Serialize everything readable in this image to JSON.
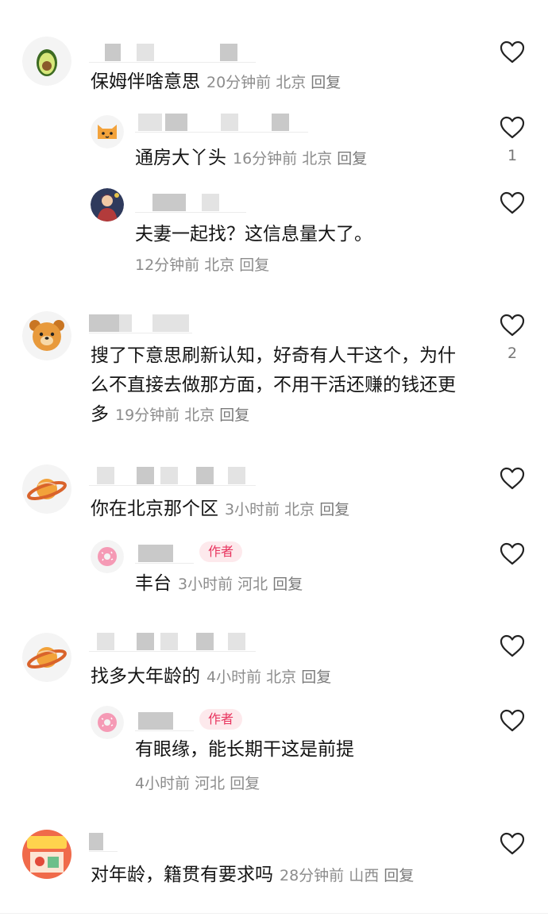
{
  "colors": {
    "badge_bg": "#fde9ec",
    "badge_text": "#e8345e",
    "meta": "#8c8c8c"
  },
  "comments": [
    {
      "avatar_icon": "avocado-icon",
      "text": "保姆伴啥意思",
      "time": "20分钟前",
      "location": "北京",
      "reply": "回复",
      "likes": "",
      "replies": [
        {
          "avatar_icon": "cat-face-icon",
          "text": "通房大丫头",
          "time": "16分钟前",
          "location": "北京",
          "reply": "回复",
          "likes": "1"
        },
        {
          "avatar_icon": "anime-character-icon",
          "text": "夫妻一起找？这信息量大了。",
          "time": "12分钟前",
          "location": "北京",
          "reply": "回复",
          "likes": ""
        }
      ]
    },
    {
      "avatar_icon": "bear-face-icon",
      "text": "搜了下意思刷新认知，好奇有人干这个，为什么不直接去做那方面，不用干活还赚的钱还更多",
      "time": "19分钟前",
      "location": "北京",
      "reply": "回复",
      "likes": "2",
      "replies": []
    },
    {
      "avatar_icon": "planet-icon",
      "text": "你在北京那个区",
      "time": "3小时前",
      "location": "北京",
      "reply": "回复",
      "likes": "",
      "replies": [
        {
          "avatar_icon": "donut-icon",
          "badge": "作者",
          "text": "丰台",
          "time": "3小时前",
          "location": "河北",
          "reply": "回复",
          "likes": ""
        }
      ]
    },
    {
      "avatar_icon": "planet-icon",
      "text": "找多大年龄的",
      "time": "4小时前",
      "location": "北京",
      "reply": "回复",
      "likes": "",
      "replies": [
        {
          "avatar_icon": "donut-icon",
          "badge": "作者",
          "text": "有眼缘，能长期干这是前提",
          "time": "4小时前",
          "location": "河北",
          "reply": "回复",
          "likes": ""
        }
      ]
    },
    {
      "avatar_icon": "shop-poster-icon",
      "text": "对年龄，籍贯有要求吗",
      "time": "28分钟前",
      "location": "山西",
      "reply": "回复",
      "likes": "",
      "replies": []
    }
  ]
}
